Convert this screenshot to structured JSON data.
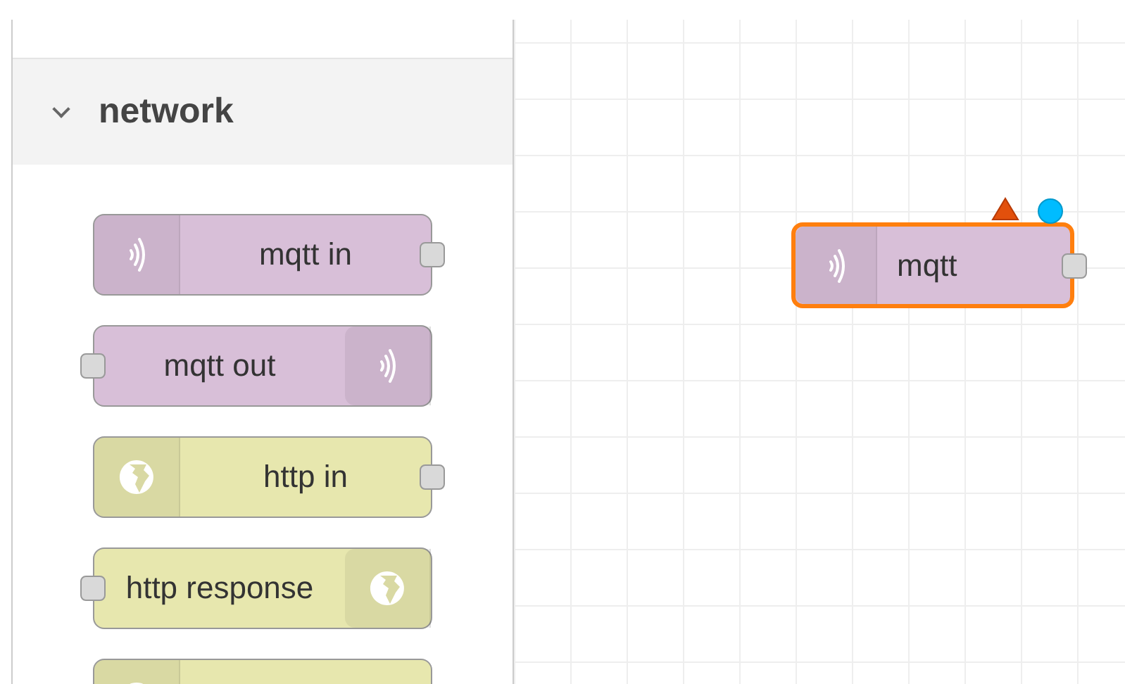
{
  "palette": {
    "category": {
      "label": "network",
      "expanded": true
    },
    "nodes": [
      {
        "label": "mqtt in",
        "kind": "input",
        "color": "#d8bfd8"
      },
      {
        "label": "mqtt out",
        "kind": "output",
        "color": "#d8bfd8"
      },
      {
        "label": "http in",
        "kind": "input",
        "color": "#e7e7ae"
      },
      {
        "label": "http response",
        "kind": "output",
        "color": "#e7e7ae"
      },
      {
        "kind": "input",
        "color": "#e7e7ae"
      }
    ]
  },
  "canvas": {
    "node": {
      "label": "mqtt",
      "kind": "input",
      "color": "#d8bfd8",
      "selected": true,
      "invalid": true,
      "changed": true
    }
  }
}
